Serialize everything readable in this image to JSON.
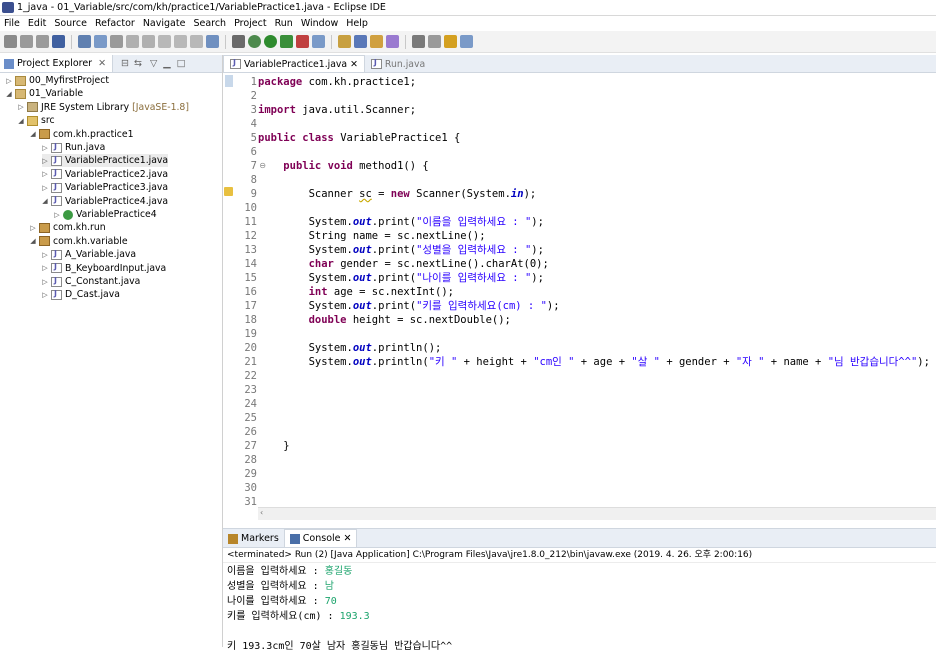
{
  "window": {
    "title": "1_java - 01_Variable/src/com/kh/practice1/VariablePractice1.java - Eclipse IDE"
  },
  "menu": [
    "File",
    "Edit",
    "Source",
    "Refactor",
    "Navigate",
    "Search",
    "Project",
    "Run",
    "Window",
    "Help"
  ],
  "toolbar_icons": [
    "new-icon",
    "save-icon",
    "save-all-icon",
    "terminal-icon",
    "skip-breakpoints-icon",
    "resume-icon",
    "suspend-icon",
    "terminate-icon",
    "disconnect-icon",
    "step-into-icon",
    "step-over-icon",
    "step-return-icon",
    "open-task-icon",
    "run-last-tool-icon",
    "debug-icon",
    "run-icon",
    "coverage-icon",
    "external-tools-icon",
    "new-class-icon",
    "new-package-icon",
    "open-type-icon",
    "open-folder-icon",
    "search-icon",
    "next-annotation-icon",
    "prev-annotation-icon",
    "back-icon",
    "forward-icon"
  ],
  "explorer": {
    "tab_label": "Project Explorer",
    "tree": [
      {
        "label": "00_MyfirstProject",
        "depth": 0,
        "icon": "project-icon",
        "expanded": false
      },
      {
        "label": "01_Variable",
        "depth": 0,
        "icon": "project-icon",
        "expanded": true
      },
      {
        "label": "JRE System Library",
        "suffix": "[JavaSE-1.8]",
        "depth": 1,
        "icon": "library-icon",
        "expanded": false
      },
      {
        "label": "src",
        "depth": 1,
        "icon": "source-folder-icon",
        "expanded": true
      },
      {
        "label": "com.kh.practice1",
        "depth": 2,
        "icon": "package-icon",
        "expanded": true
      },
      {
        "label": "Run.java",
        "depth": 3,
        "icon": "java-file-icon",
        "expanded": false
      },
      {
        "label": "VariablePractice1.java",
        "depth": 3,
        "icon": "java-file-icon",
        "expanded": false,
        "selected": true
      },
      {
        "label": "VariablePractice2.java",
        "depth": 3,
        "icon": "java-file-icon",
        "expanded": false
      },
      {
        "label": "VariablePractice3.java",
        "depth": 3,
        "icon": "java-file-icon",
        "expanded": false
      },
      {
        "label": "VariablePractice4.java",
        "depth": 3,
        "icon": "java-file-icon",
        "expanded": true
      },
      {
        "label": "VariablePractice4",
        "depth": 4,
        "icon": "class-icon",
        "expanded": false
      },
      {
        "label": "com.kh.run",
        "depth": 2,
        "icon": "package-icon",
        "expanded": false
      },
      {
        "label": "com.kh.variable",
        "depth": 2,
        "icon": "package-icon",
        "expanded": true
      },
      {
        "label": "A_Variable.java",
        "depth": 3,
        "icon": "java-file-icon",
        "expanded": false
      },
      {
        "label": "B_KeyboardInput.java",
        "depth": 3,
        "icon": "java-file-icon",
        "expanded": false
      },
      {
        "label": "C_Constant.java",
        "depth": 3,
        "icon": "java-file-icon",
        "expanded": false
      },
      {
        "label": "D_Cast.java",
        "depth": 3,
        "icon": "java-file-icon",
        "expanded": false
      }
    ]
  },
  "editor": {
    "tabs": [
      {
        "label": "VariablePractice1.java",
        "active": true
      },
      {
        "label": "Run.java",
        "active": false
      }
    ],
    "lines": [
      [
        [
          "kw",
          "package"
        ],
        [
          "t",
          " com.kh.practice1;"
        ]
      ],
      [],
      [
        [
          "kw",
          "import"
        ],
        [
          "t",
          " java.util.Scanner;"
        ]
      ],
      [],
      [
        [
          "kw",
          "public"
        ],
        [
          "t",
          " "
        ],
        [
          "kw",
          "class"
        ],
        [
          "t",
          " VariablePractice1 {"
        ]
      ],
      [],
      [
        [
          "t",
          "    "
        ],
        [
          "kw",
          "public"
        ],
        [
          "t",
          " "
        ],
        [
          "kw",
          "void"
        ],
        [
          "t",
          " method1() {"
        ]
      ],
      [],
      [
        [
          "t",
          "        Scanner "
        ],
        [
          "w",
          "sc"
        ],
        [
          "t",
          " = "
        ],
        [
          "kw",
          "new"
        ],
        [
          "t",
          " Scanner(System."
        ],
        [
          "f",
          "in"
        ],
        [
          "t",
          ");"
        ]
      ],
      [],
      [
        [
          "t",
          "        System."
        ],
        [
          "f",
          "out"
        ],
        [
          "t",
          ".print("
        ],
        [
          "s",
          "\"이름을 입력하세요 : \""
        ],
        [
          "t",
          ");"
        ]
      ],
      [
        [
          "t",
          "        String name = sc.nextLine();"
        ]
      ],
      [
        [
          "t",
          "        System."
        ],
        [
          "f",
          "out"
        ],
        [
          "t",
          ".print("
        ],
        [
          "s",
          "\"성별을 입력하세요 : \""
        ],
        [
          "t",
          ");"
        ]
      ],
      [
        [
          "t",
          "        "
        ],
        [
          "kw",
          "char"
        ],
        [
          "t",
          " gender = sc.nextLine().charAt(0);"
        ]
      ],
      [
        [
          "t",
          "        System."
        ],
        [
          "f",
          "out"
        ],
        [
          "t",
          ".print("
        ],
        [
          "s",
          "\"나이를 입력하세요 : \""
        ],
        [
          "t",
          ");"
        ]
      ],
      [
        [
          "t",
          "        "
        ],
        [
          "kw",
          "int"
        ],
        [
          "t",
          " age = sc.nextInt();"
        ]
      ],
      [
        [
          "t",
          "        System."
        ],
        [
          "f",
          "out"
        ],
        [
          "t",
          ".print("
        ],
        [
          "s",
          "\"키를 입력하세요(cm) : \""
        ],
        [
          "t",
          ");"
        ]
      ],
      [
        [
          "t",
          "        "
        ],
        [
          "kw",
          "double"
        ],
        [
          "t",
          " height = sc.nextDouble();"
        ]
      ],
      [],
      [
        [
          "t",
          "        System."
        ],
        [
          "f",
          "out"
        ],
        [
          "t",
          ".println();"
        ]
      ],
      [
        [
          "t",
          "        System."
        ],
        [
          "f",
          "out"
        ],
        [
          "t",
          ".println("
        ],
        [
          "s",
          "\"키 \""
        ],
        [
          "t",
          " + height + "
        ],
        [
          "s",
          "\"cm인 \""
        ],
        [
          "t",
          " + age + "
        ],
        [
          "s",
          "\"살 \""
        ],
        [
          "t",
          " + gender + "
        ],
        [
          "s",
          "\"자 \""
        ],
        [
          "t",
          " + name + "
        ],
        [
          "s",
          "\"님 반갑습니다^^\""
        ],
        [
          "t",
          ");"
        ]
      ],
      [],
      [],
      [],
      [],
      [],
      [
        [
          "t",
          "    }"
        ]
      ],
      [],
      [],
      [],
      []
    ]
  },
  "bottom": {
    "tabs": [
      {
        "label": "Markers",
        "active": false
      },
      {
        "label": "Console",
        "active": true
      }
    ],
    "status": "<terminated> Run (2) [Java Application] C:\\Program Files\\Java\\jre1.8.0_212\\bin\\javaw.exe (2019. 4. 26. 오후 2:00:16)",
    "console": [
      {
        "prompt": "이름을 입력하세요 : ",
        "input": "홍길동"
      },
      {
        "prompt": "성별을 입력하세요 : ",
        "input": "남"
      },
      {
        "prompt": "나이를 입력하세요 : ",
        "input": "70"
      },
      {
        "prompt": "키를 입력하세요(cm) : ",
        "input": "193.3"
      },
      {
        "prompt": "",
        "input": ""
      },
      {
        "prompt": "키 193.3cm인 70살 남자 홍길동님 반갑습니다^^",
        "input": ""
      }
    ]
  },
  "colors": {
    "keyword": "#7f0055",
    "string": "#2a00ff",
    "field": "#0000c0",
    "console_input": "#1aa36b"
  }
}
